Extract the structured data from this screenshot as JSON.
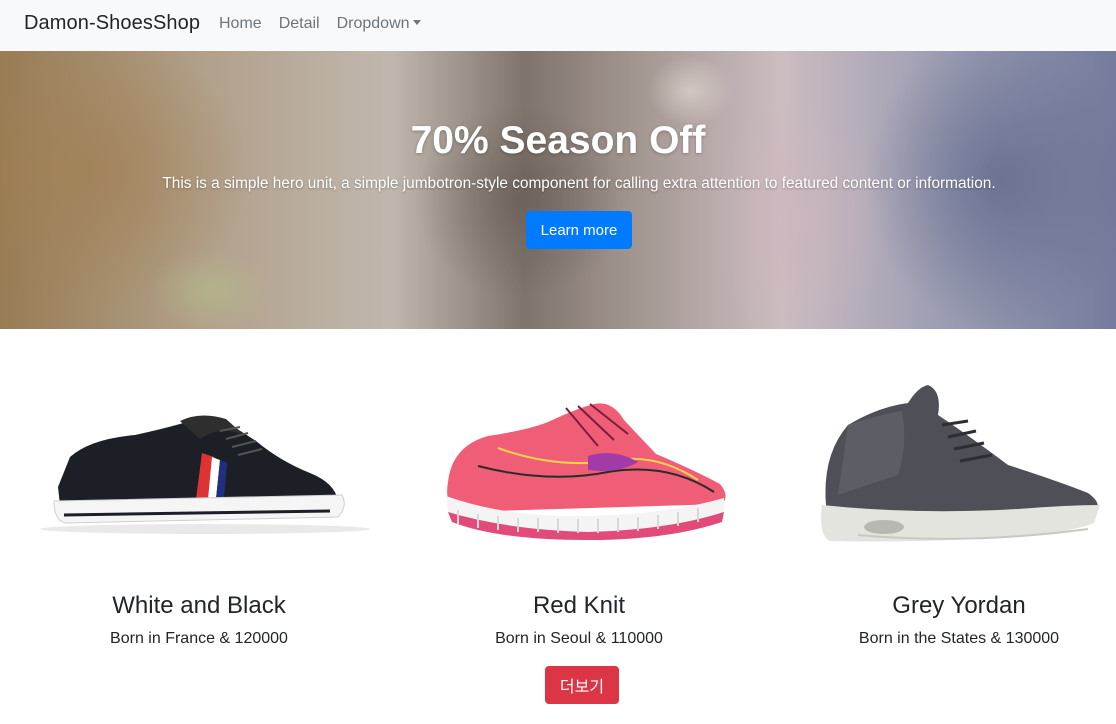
{
  "navbar": {
    "brand": "Damon-ShoesShop",
    "links": [
      "Home",
      "Detail",
      "Dropdown"
    ]
  },
  "hero": {
    "title": "70% Season Off",
    "text": "This is a simple hero unit, a simple jumbotron-style component for calling extra attention to featured content or information.",
    "button": "Learn more"
  },
  "products": [
    {
      "name": "White and Black",
      "desc": "Born in France & 120000",
      "color": "#1f2430"
    },
    {
      "name": "Red Knit",
      "desc": "Born in Seoul & 110000",
      "color": "#e8506a"
    },
    {
      "name": "Grey Yordan",
      "desc": "Born in the States & 130000",
      "color": "#4c4d55"
    }
  ],
  "more_button": "더보기",
  "colors": {
    "primary": "#007bff",
    "danger": "#dc3545",
    "navbar_bg": "#f8f9fa"
  }
}
